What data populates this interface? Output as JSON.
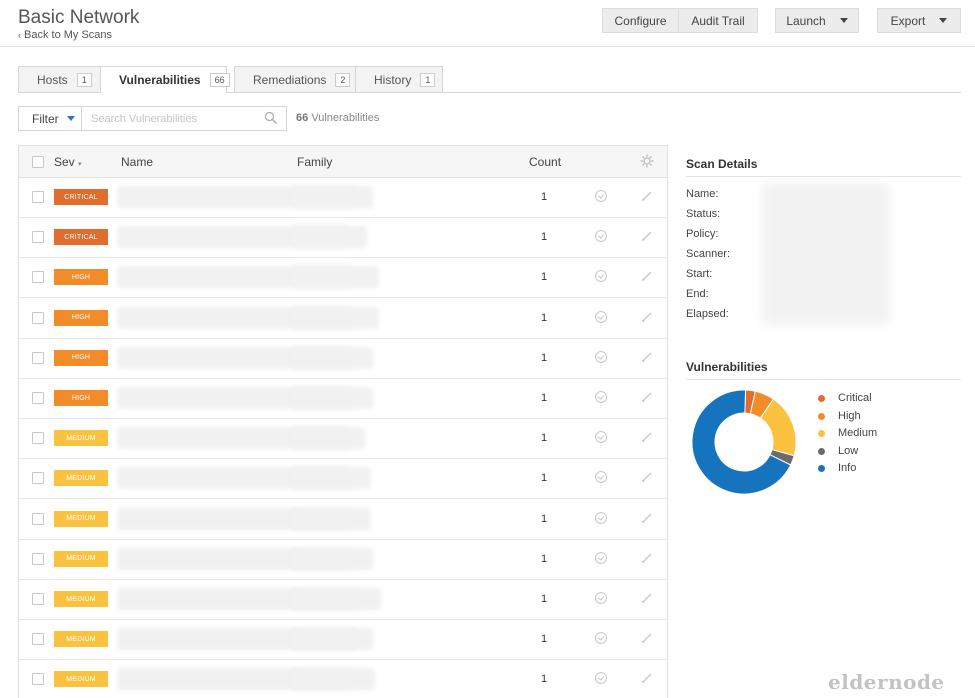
{
  "header": {
    "title": "Basic Network",
    "back_label": "Back to My Scans",
    "buttons": {
      "configure": "Configure",
      "audit_trail": "Audit Trail",
      "launch": "Launch",
      "export": "Export"
    }
  },
  "tabs": [
    {
      "label": "Hosts",
      "count": "1"
    },
    {
      "label": "Vulnerabilities",
      "count": "66"
    },
    {
      "label": "Remediations",
      "count": "2"
    },
    {
      "label": "History",
      "count": "1"
    }
  ],
  "filter": {
    "label": "Filter",
    "search_placeholder": "Search Vulnerabilities",
    "count_number": "66",
    "count_label": "Vulnerabilities"
  },
  "table": {
    "columns": {
      "sev": "Sev",
      "name": "Name",
      "family": "Family",
      "count": "Count"
    },
    "rows": [
      {
        "severity": "CRITICAL",
        "count": "1"
      },
      {
        "severity": "CRITICAL",
        "count": "1"
      },
      {
        "severity": "HIGH",
        "count": "1"
      },
      {
        "severity": "HIGH",
        "count": "1"
      },
      {
        "severity": "HIGH",
        "count": "1"
      },
      {
        "severity": "HIGH",
        "count": "1"
      },
      {
        "severity": "MEDIUM",
        "count": "1"
      },
      {
        "severity": "MEDIUM",
        "count": "1"
      },
      {
        "severity": "MEDIUM",
        "count": "1"
      },
      {
        "severity": "MEDIUM",
        "count": "1"
      },
      {
        "severity": "MEDIUM",
        "count": "1"
      },
      {
        "severity": "MEDIUM",
        "count": "1"
      },
      {
        "severity": "MEDIUM",
        "count": "1"
      }
    ]
  },
  "scan_details": {
    "title": "Scan Details",
    "labels": [
      "Name:",
      "Status:",
      "Policy:",
      "Scanner:",
      "Start:",
      "End:",
      "Elapsed:"
    ]
  },
  "vulnerabilities_panel": {
    "title": "Vulnerabilities",
    "legend": [
      {
        "label": "Critical",
        "color": "#e06c2e"
      },
      {
        "label": "High",
        "color": "#f28c29"
      },
      {
        "label": "Medium",
        "color": "#fbc23f"
      },
      {
        "label": "Low",
        "color": "#6b6b6b"
      },
      {
        "label": "Info",
        "color": "#1673bd"
      }
    ]
  },
  "chart_data": {
    "type": "pie",
    "categories": [
      "Critical",
      "High",
      "Medium",
      "Low",
      "Info"
    ],
    "values": [
      2,
      4,
      13,
      2,
      45
    ]
  },
  "severity_colors": {
    "CRITICAL": "#e06c2e",
    "HIGH": "#f28c29",
    "MEDIUM": "#fbc23f"
  },
  "watermark": "eldernode"
}
